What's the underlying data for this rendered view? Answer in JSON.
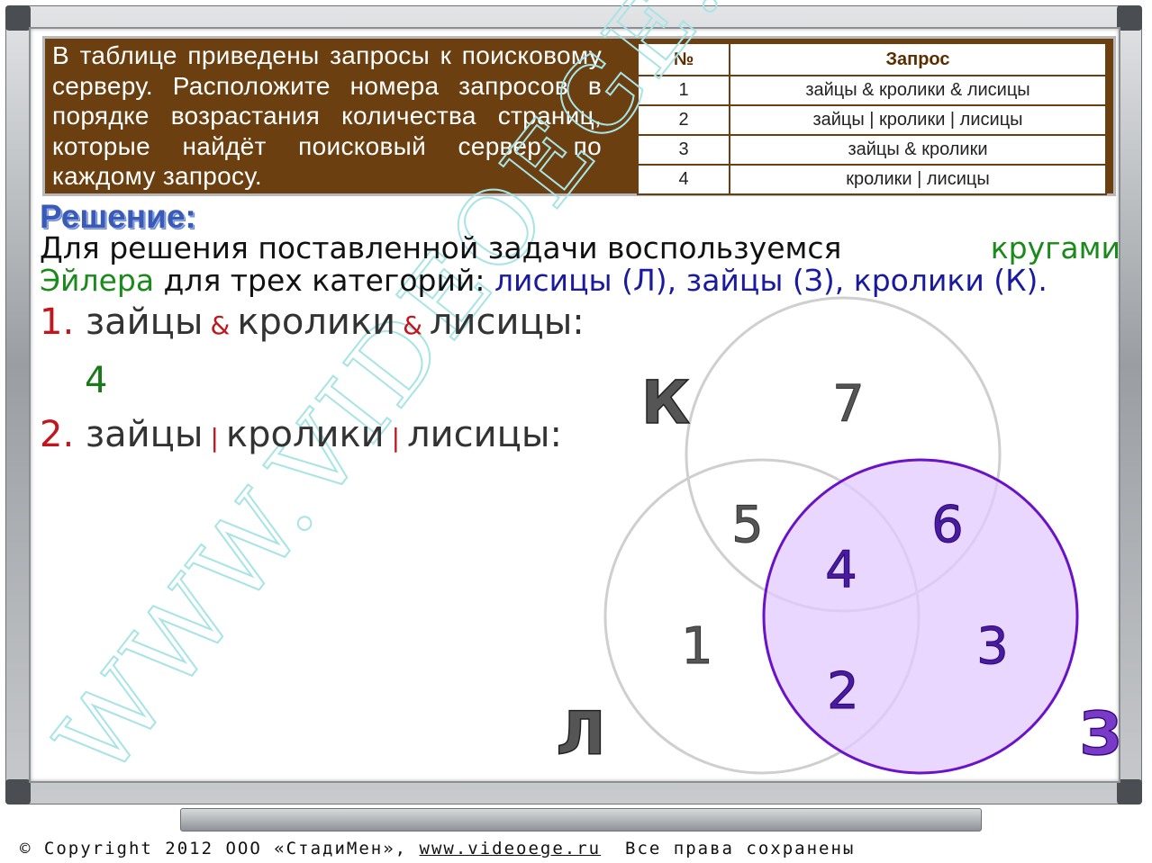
{
  "task": {
    "text": "В таблице приведены запросы к поисковому серверу. Расположите номера запросов в порядке возрастания количества страниц, которые найдёт поисковый сервер по каждому запросу.",
    "table": {
      "headers": [
        "№",
        "Запрос"
      ],
      "rows": [
        [
          "1",
          "зайцы & кролики & лисицы"
        ],
        [
          "2",
          "зайцы | кролики | лисицы"
        ],
        [
          "3",
          "зайцы & кролики"
        ],
        [
          "4",
          "кролики | лисицы"
        ]
      ]
    }
  },
  "solution": {
    "title": "Решение:",
    "intro_part1": "Для решения поставленной задачи воспользуемся",
    "intro_highlight1": "кругами",
    "intro_highlight2": "Эйлера",
    "intro_part2": " для трех категорий: ",
    "cat_l": "лисицы (Л),",
    "cat_z": "зайцы (З),",
    "cat_k": "кролики (К)."
  },
  "steps": [
    {
      "num": "1.",
      "w1": "зайцы",
      "op1": "&",
      "w2": "кролики",
      "op2": "&",
      "w3": "лисицы:",
      "answer": "4"
    },
    {
      "num": "2.",
      "w1": "зайцы",
      "op1": "|",
      "w2": "кролики",
      "op2": "|",
      "w3": "лисицы:"
    }
  ],
  "venn": {
    "labels": {
      "k": "К",
      "l": "Л",
      "z": "З"
    },
    "regions": [
      "1",
      "2",
      "3",
      "4",
      "5",
      "6",
      "7"
    ],
    "highlight_color": "#e2caff",
    "highlight_stroke": "#6a12c8"
  },
  "watermark": "WWW.VIDEOEGE.RU",
  "copyright": {
    "prefix": "Copyright 2012 ООО «СтадиМен»,",
    "link": "www.videoege.ru",
    "suffix": "Все права сохранены"
  }
}
